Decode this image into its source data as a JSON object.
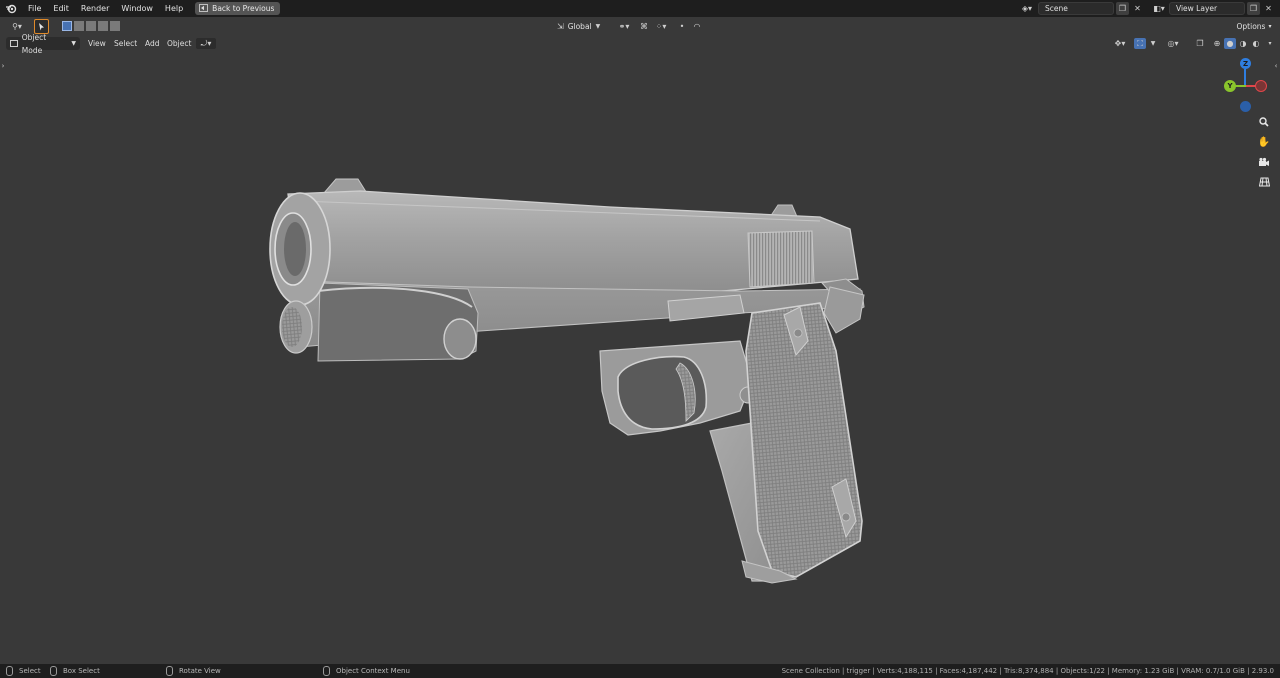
{
  "menu": {
    "items": [
      "File",
      "Edit",
      "Render",
      "Window",
      "Help"
    ],
    "back_label": "Back to Previous"
  },
  "scene": {
    "label": "Scene"
  },
  "view_layer": {
    "label": "View Layer"
  },
  "toolbar": {
    "transform_orientation": "Global",
    "options_label": "Options"
  },
  "header": {
    "mode": "Object Mode",
    "menus": [
      "View",
      "Select",
      "Add",
      "Object"
    ]
  },
  "gizmo": {
    "z": "Z",
    "y": "Y",
    "x": "X"
  },
  "nav_icons": [
    "zoom-icon",
    "hand-pan-icon",
    "camera-icon",
    "grid-ortho-icon"
  ],
  "status": {
    "select": "Select",
    "box_select": "Box Select",
    "rotate_view": "Rotate View",
    "context_menu": "Object Context Menu",
    "stats": "Scene Collection | trigger | Verts:4,188,115 | Faces:4,187,442 | Tris:8,374,884 | Objects:1/22 | Memory: 1.23 GiB | VRAM: 0.7/1.0 GiB | 2.93.0"
  },
  "colors": {
    "axis_x": "#e0464a",
    "axis_y": "#8ac52c",
    "axis_z": "#2f7ee0",
    "accent": "#4772b3",
    "model": "#a7a7a7"
  }
}
